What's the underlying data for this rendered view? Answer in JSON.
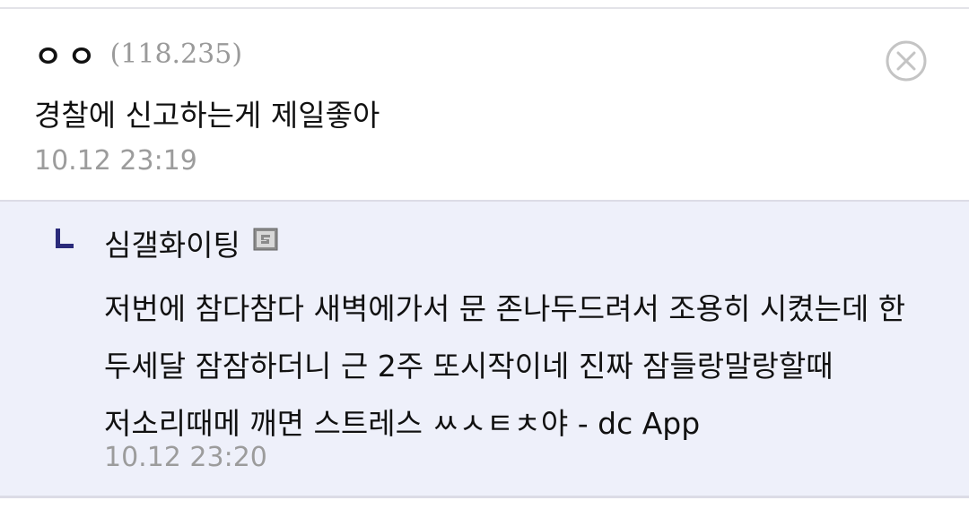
{
  "comment": {
    "nickname": "ㅇㅇ",
    "ip": "(118.235)",
    "text": "경찰에 신고하는게 제일좋아",
    "time": "10.12 23:19",
    "close_icon": "close-circle-icon"
  },
  "reply": {
    "nickname": "심갤화이팅",
    "gallery_icon": "gallery-badge-icon",
    "text": "저번에 참다참다 새벽에가서 문 존나두드려서 조용히 시켰는데 한 두세달 잠잠하더니 근 2주 또시작이네 진짜 잠들랑말랑할때 저소리때메 깨면 스트레스 ㅆㅅㅌㅊ야 - dc App",
    "time": "10.12 23:20"
  },
  "colors": {
    "reply_background": "#eef0fa",
    "reply_marker": "#2a2a7a",
    "muted_text": "#9c9c9c",
    "border": "#dcdce6"
  }
}
